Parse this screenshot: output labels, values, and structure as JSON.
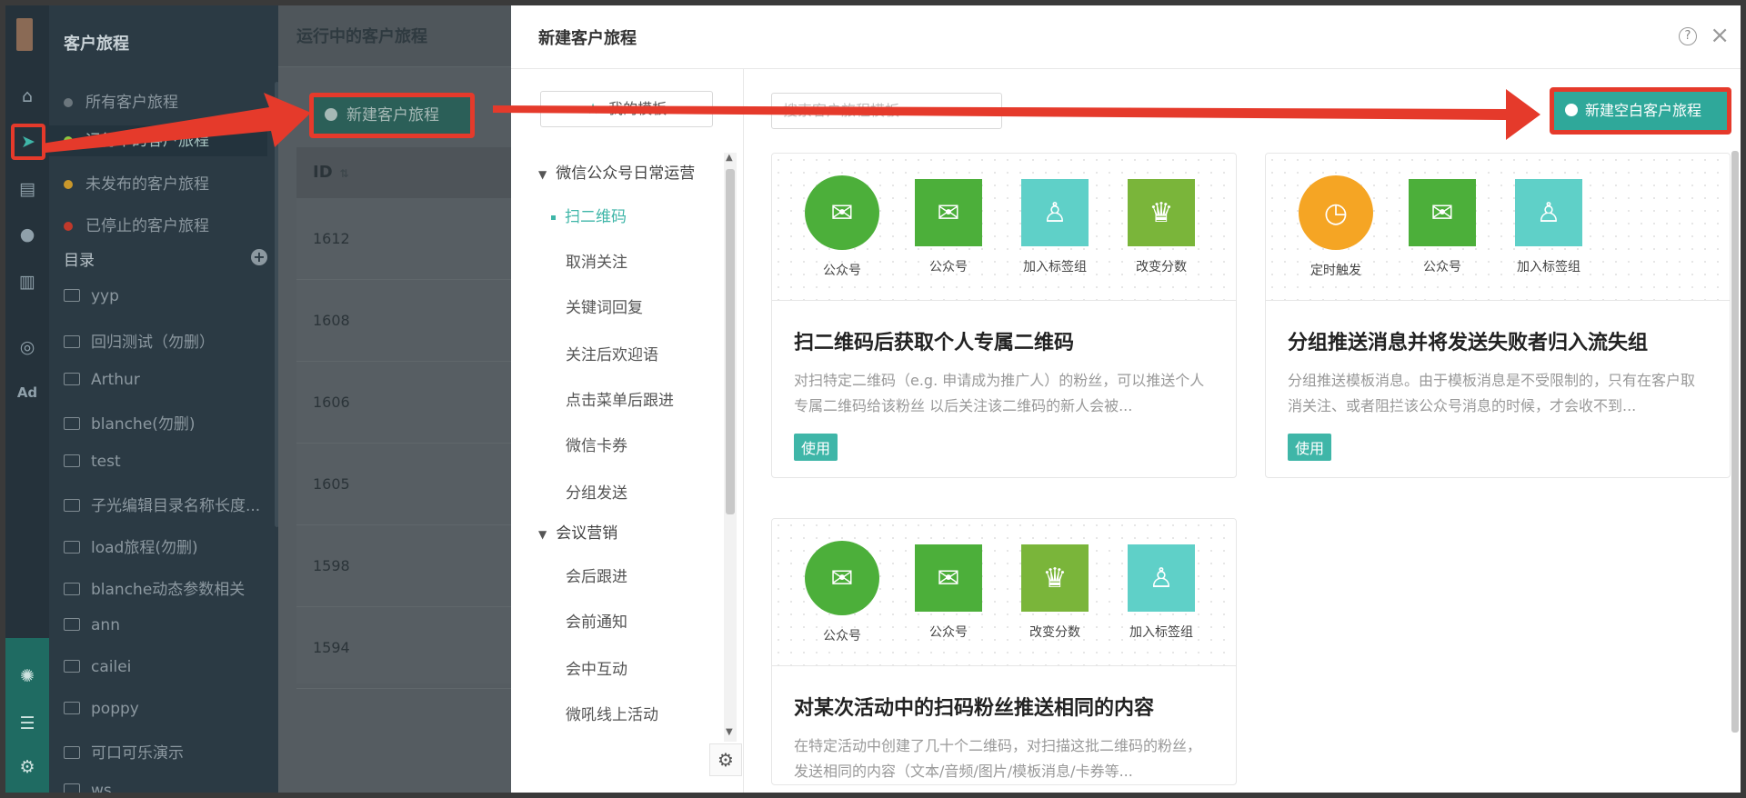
{
  "sidebar": {
    "title": "客户旅程",
    "nav": [
      {
        "label": "所有客户旅程",
        "color": "#6b767d"
      },
      {
        "label": "运行中的客户旅程",
        "color": "#8cc63f"
      },
      {
        "label": "未发布的客户旅程",
        "color": "#c9972b"
      },
      {
        "label": "已停止的客户旅程",
        "color": "#c0392b"
      }
    ],
    "section_title": "目录",
    "section_add": "+",
    "folders": [
      "yyp",
      "回归测试（勿删）",
      "Arthur",
      "blanche(勿删)",
      "test",
      "子光编辑目录名称长度...",
      "load旅程(勿删)",
      "blanche动态参数相关",
      "ann",
      "cailei",
      "poppy",
      "可口可乐演示",
      "ws"
    ]
  },
  "rail": {
    "icons": [
      "home-icon",
      "send-icon",
      "layout-icon",
      "user-icon",
      "chart-icon",
      "wechat-icon",
      "ad-icon"
    ],
    "ad_label": "Ad"
  },
  "list": {
    "title": "运行中的客户旅程",
    "new_button": "新建客户旅程",
    "column_id": "ID",
    "rows": [
      "1612",
      "1608",
      "1606",
      "1605",
      "1598",
      "1594"
    ]
  },
  "modal": {
    "title": "新建客户旅程",
    "help": "?",
    "close": "×",
    "my_templates": "我的模板",
    "search_placeholder": "搜索客户旅程模板",
    "new_blank_button": "新建空白客户旅程",
    "groups": [
      {
        "label": "微信公众号日常运营",
        "items": [
          "扫二维码",
          "取消关注",
          "关键词回复",
          "关注后欢迎语",
          "点击菜单后跟进",
          "微信卡券",
          "分组发送"
        ]
      },
      {
        "label": "会议营销",
        "items": [
          "会后跟进",
          "会前通知",
          "会中互动",
          "微吼线上活动"
        ]
      }
    ],
    "selected_item": "扫二维码",
    "use_label": "使用",
    "cards": [
      {
        "title": "扫二维码后获取个人专属二维码",
        "desc": "对扫特定二维码（e.g. 申请成为推广人）的粉丝，可以推送个人专属二维码给该粉丝 以后关注该二维码的新人会被...",
        "nodes": [
          {
            "label": "公众号",
            "kind": "wx",
            "shape": "circle"
          },
          {
            "label": "公众号",
            "kind": "wx",
            "shape": "square"
          },
          {
            "label": "加入标签组",
            "kind": "tag",
            "shape": "square"
          },
          {
            "label": "改变分数",
            "kind": "score",
            "shape": "square"
          }
        ]
      },
      {
        "title": "分组推送消息并将发送失败者归入流失组",
        "desc": "分组推送模板消息。由于模板消息是不受限制的，只有在客户取消关注、或者阻拦该公众号消息的时候，才会收不到...",
        "nodes": [
          {
            "label": "定时触发",
            "kind": "timer",
            "shape": "circle"
          },
          {
            "label": "公众号",
            "kind": "wx",
            "shape": "square"
          },
          {
            "label": "加入标签组",
            "kind": "tag",
            "shape": "square"
          }
        ]
      },
      {
        "title": "对某次活动中的扫码粉丝推送相同的内容",
        "desc": "在特定活动中创建了几十个二维码，对扫描这批二维码的粉丝，发送相同的内容（文本/音频/图片/模板消息/卡券等...",
        "nodes": [
          {
            "label": "公众号",
            "kind": "wx",
            "shape": "circle"
          },
          {
            "label": "公众号",
            "kind": "wx",
            "shape": "square"
          },
          {
            "label": "改变分数",
            "kind": "score",
            "shape": "square"
          },
          {
            "label": "加入标签组",
            "kind": "tag",
            "shape": "square"
          }
        ]
      }
    ]
  },
  "colors": {
    "accent": "#3fb6a8",
    "highlight": "#e53a2b"
  }
}
